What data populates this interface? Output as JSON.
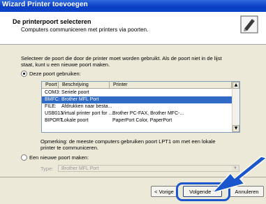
{
  "window": {
    "title": "Wizard Printer toevoegen"
  },
  "header": {
    "title": "De printerpoort selecteren",
    "subtitle": "Computers communiceren met printers via poorten."
  },
  "instruction": {
    "line1": "Selecteer de poort die door de printer moet worden gebruikt. Als de poort niet in de lijst",
    "line2": "staat, kunt u een nieuwe poort maken."
  },
  "use_port": {
    "label": "Deze poort gebruiken:",
    "selected": true
  },
  "port_table": {
    "columns": [
      "Poort",
      "Beschrijving",
      "Printer"
    ],
    "rows": [
      {
        "port": "COM3:",
        "description": "Seriele poort",
        "printer": "",
        "selected": false
      },
      {
        "port": "BMFC:",
        "description": "Brother MFL Port",
        "printer": "",
        "selected": true
      },
      {
        "port": "FILE:",
        "description": "Afdrukken naar besta...",
        "printer": "",
        "selected": false
      },
      {
        "port": "USB013",
        "description": "Virtual printer port for ...",
        "printer": "Brother PC-FAX, Brother MFC-...",
        "selected": false
      },
      {
        "port": "BIPORT",
        "description": "Lokale poort",
        "printer": "PaperPort Color, PaperPort",
        "selected": false
      }
    ]
  },
  "note": {
    "line1": "Opmerking: de meeste computers gebruiken poort LPT1 om met een lokale",
    "line2": "printer te communiceren."
  },
  "new_port": {
    "label": "Een nieuwe poort maken:",
    "selected": false,
    "type_label": "Type:",
    "type_value": "Brother MFL Port"
  },
  "buttons": {
    "back": "< Vorige",
    "next": "Volgende >",
    "cancel": "Annuleren"
  },
  "colors": {
    "selection": "#316ac5",
    "title_bar": "#0a3fc4",
    "callout": "#1a56cc"
  }
}
